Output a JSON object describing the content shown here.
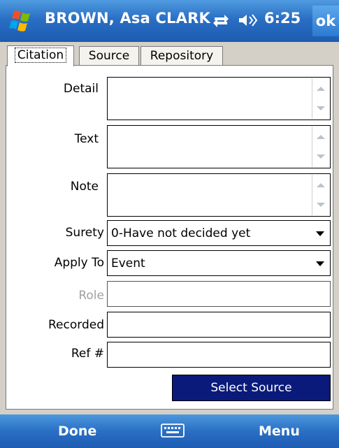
{
  "titlebar": {
    "title": "BROWN, Asa CLARK",
    "clock": "6:25",
    "ok_label": "ok",
    "start_icon": "windows-flag-icon",
    "connectivity_icon": "connectivity-icon",
    "volume_icon": "volume-icon"
  },
  "tabs": [
    {
      "label": "Citation",
      "active": true
    },
    {
      "label": "Source",
      "active": false
    },
    {
      "label": "Repository",
      "active": false
    }
  ],
  "form": {
    "detail": {
      "label": "Detail",
      "value": ""
    },
    "text": {
      "label": "Text",
      "value": ""
    },
    "note": {
      "label": "Note",
      "value": ""
    },
    "surety": {
      "label": "Surety",
      "value": "0-Have not decided yet"
    },
    "apply_to": {
      "label": "Apply To",
      "value": "Event"
    },
    "role": {
      "label": "Role",
      "value": "",
      "disabled": true
    },
    "recorded": {
      "label": "Recorded",
      "value": ""
    },
    "ref": {
      "label": "Ref #",
      "value": ""
    }
  },
  "select_source_label": "Select Source",
  "softkeys": {
    "left": "Done",
    "right": "Menu",
    "center_icon": "keyboard-icon"
  },
  "colors": {
    "titlebar_blue": "#2a6fc5",
    "select_button_bg": "#0a1a7a",
    "frame_gray": "#d4d0c8"
  }
}
